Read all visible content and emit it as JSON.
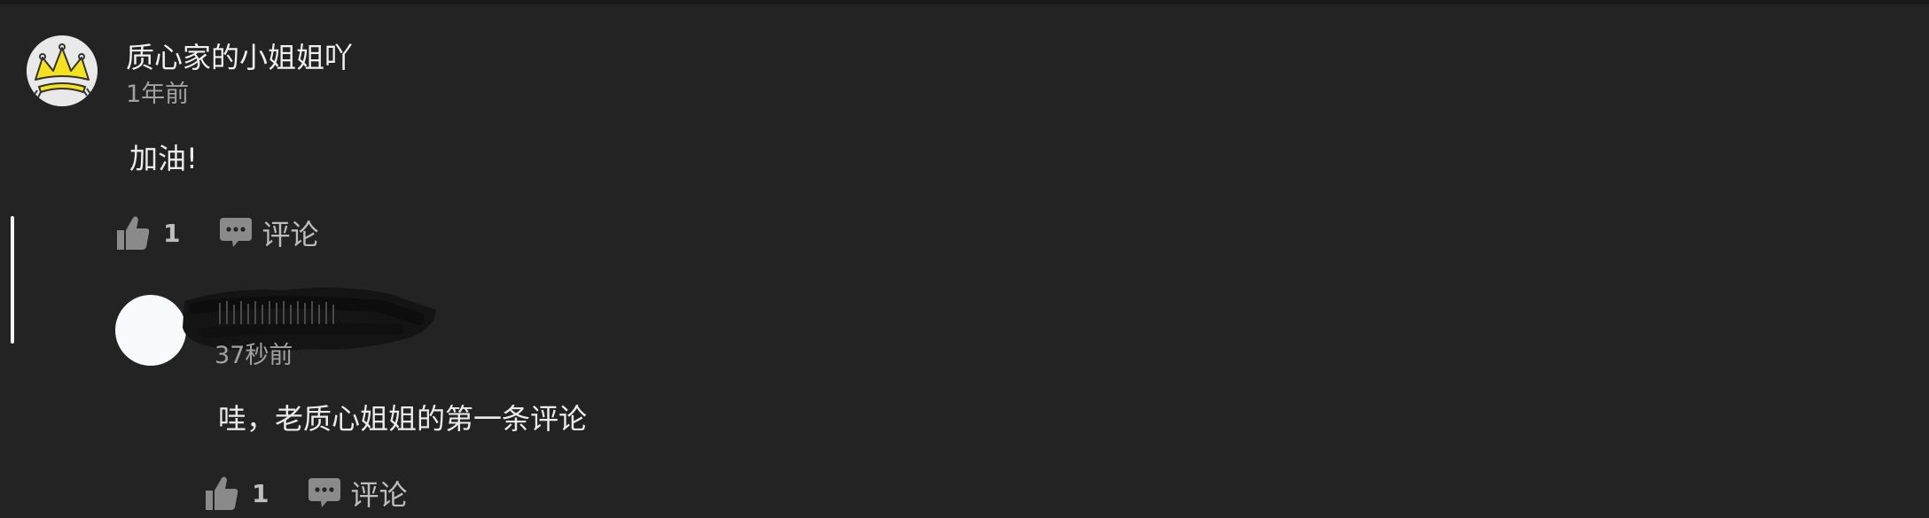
{
  "comment": {
    "author": "质心家的小姐姐吖",
    "time": "1年前",
    "text": "加油!",
    "likes": "1",
    "reply_label": "评论"
  },
  "reply": {
    "time": "37秒前",
    "text": "哇，老质心姐姐的第一条评论",
    "likes": "1",
    "reply_label": "评论"
  },
  "icons": {
    "like": "thumbs-up-icon",
    "comment": "speech-bubble-icon",
    "avatar_main": "crown-avatar-icon"
  },
  "colors": {
    "background": "#232323",
    "icon": "#8a8a8a",
    "crown": "#f4e21c"
  }
}
